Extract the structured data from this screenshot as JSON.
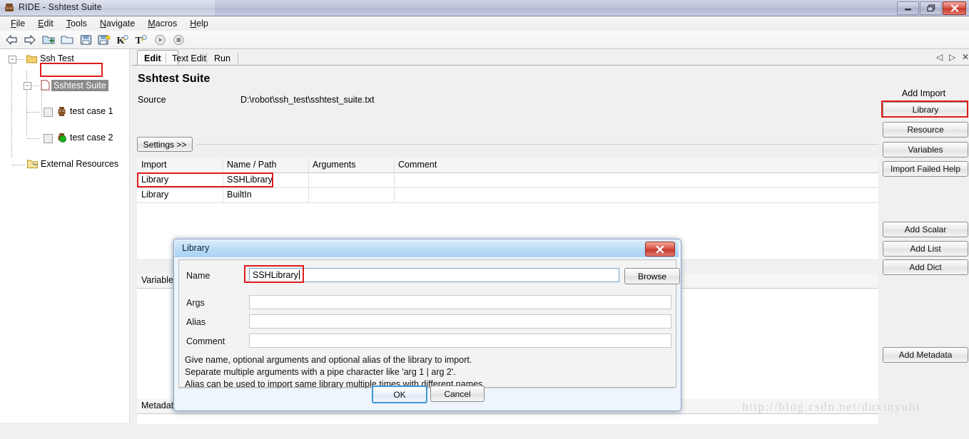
{
  "window": {
    "title": "RIDE - Sshtest Suite",
    "app_icon": "ride-robot-icon",
    "controls": [
      {
        "name": "minimize-button",
        "glyph": "—"
      },
      {
        "name": "restore-button",
        "glyph": "❐"
      },
      {
        "name": "close-button",
        "glyph": "✕"
      }
    ]
  },
  "menubar": {
    "items": [
      {
        "label": "File",
        "mnemonic": "F"
      },
      {
        "label": "Edit",
        "mnemonic": "E"
      },
      {
        "label": "Tools",
        "mnemonic": "T"
      },
      {
        "label": "Navigate",
        "mnemonic": "N"
      },
      {
        "label": "Macros",
        "mnemonic": "M"
      },
      {
        "label": "Help",
        "mnemonic": "H"
      }
    ]
  },
  "toolbar": {
    "buttons": [
      {
        "name": "back-arrow-icon",
        "label": "Back"
      },
      {
        "name": "forward-arrow-icon",
        "label": "Forward"
      },
      {
        "name": "new-project-folder-icon",
        "label": "New Project"
      },
      {
        "name": "open-folder-icon",
        "label": "Open"
      },
      {
        "name": "save-floppy-icon",
        "label": "Save"
      },
      {
        "name": "save-all-floppy-icon",
        "label": "Save All"
      },
      {
        "name": "search-keyword-icon",
        "label": "Search Keywords"
      },
      {
        "name": "search-tests-icon",
        "label": "Search Tests"
      },
      {
        "name": "run-play-icon",
        "label": "Run"
      },
      {
        "name": "stop-icon",
        "label": "Stop"
      }
    ]
  },
  "tree": {
    "nodes": [
      {
        "label": "Ssh Test",
        "icon": "folder-icon",
        "expander": "-",
        "selected": false,
        "checkbox": false,
        "depth": 0
      },
      {
        "label": "Sshtest Suite",
        "icon": "file-icon",
        "expander": "-",
        "selected": true,
        "checkbox": false,
        "depth": 1
      },
      {
        "label": "test case 1",
        "icon": "testcase-icon",
        "expander": "",
        "selected": false,
        "checkbox": true,
        "depth": 2
      },
      {
        "label": "test case 2",
        "icon": "testcase-pass-icon",
        "expander": "",
        "selected": false,
        "checkbox": true,
        "depth": 2
      },
      {
        "label": "External Resources",
        "icon": "external-resources-icon",
        "expander": "",
        "selected": false,
        "checkbox": false,
        "depth": 1
      }
    ]
  },
  "tabs": {
    "items": [
      {
        "label": "Edit",
        "active": true
      },
      {
        "label": "Text Edit",
        "active": false
      },
      {
        "label": "Run",
        "active": false
      }
    ],
    "controls": [
      {
        "name": "tab-prev-icon",
        "glyph": "◁"
      },
      {
        "name": "tab-next-icon",
        "glyph": "▷"
      },
      {
        "name": "tab-close-icon",
        "glyph": "✕"
      }
    ]
  },
  "editor": {
    "suite_title": "Sshtest Suite",
    "source_label": "Source",
    "source_value": "D:\\robot\\ssh_test\\sshtest_suite.txt",
    "settings_button": "Settings >>",
    "import_table": {
      "headers": [
        "Import",
        "Name / Path",
        "Arguments",
        "Comment"
      ],
      "rows": [
        {
          "import": "Library",
          "name_path": "SSHLibrary",
          "arguments": "",
          "comment": "",
          "highlighted": true
        },
        {
          "import": "Library",
          "name_path": "BuiltIn",
          "arguments": "",
          "comment": "",
          "highlighted": false
        }
      ]
    },
    "variable_header": "Variable",
    "metadata_header": "Metadata"
  },
  "side_panel": {
    "add_import_title": "Add Import",
    "import_buttons": [
      {
        "label": "Library",
        "highlighted": true
      },
      {
        "label": "Resource",
        "highlighted": false
      },
      {
        "label": "Variables",
        "highlighted": false
      },
      {
        "label": "Import Failed Help",
        "highlighted": false
      }
    ],
    "variable_buttons": [
      {
        "label": "Add Scalar"
      },
      {
        "label": "Add List"
      },
      {
        "label": "Add Dict"
      }
    ],
    "metadata_button": "Add Metadata"
  },
  "dialog": {
    "title": "Library",
    "close_glyph": "✕",
    "fields": [
      {
        "label": "Name",
        "value": "SSHLibrary",
        "placeholder": "",
        "focused": true,
        "highlighted": true
      },
      {
        "label": "Args",
        "value": "",
        "placeholder": "",
        "focused": false,
        "highlighted": false
      },
      {
        "label": "Alias",
        "value": "",
        "placeholder": "",
        "focused": false,
        "highlighted": false
      },
      {
        "label": "Comment",
        "value": "",
        "placeholder": "",
        "focused": false,
        "highlighted": false
      }
    ],
    "browse_button": "Browse",
    "help_lines": [
      "Give name, optional arguments and optional alias of the library to import.",
      "Separate multiple arguments with a pipe character like 'arg 1 | arg 2'.",
      "Alias can be used to import same library multiple times with different names."
    ],
    "ok_button": "OK",
    "cancel_button": "Cancel"
  },
  "watermark": "http://blog.csdn.net/duxinyuhi",
  "colors": {
    "highlight_red": "#e01b1b",
    "dialog_title": "#b9dcf7",
    "selection_gray": "#8a8a8a",
    "focus_blue": "#3c97d8"
  }
}
